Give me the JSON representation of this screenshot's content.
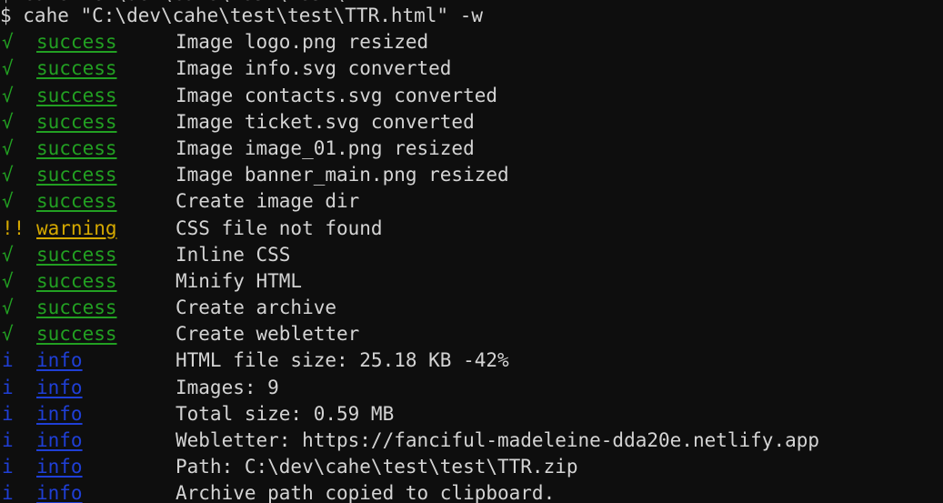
{
  "terminal": {
    "background_color": "#0e0e0e",
    "foreground_color": "#d4d4d4",
    "scrollback_partial_line": "$ cahe \"C:\\dev\\cahe\\test\\test\\TTR.html\" -w",
    "prompt_symbol": "$",
    "command_line": "$ cahe \"C:\\dev\\cahe\\test\\test\\TTR.html\" -w"
  },
  "colors": {
    "success": "#22a022",
    "warning": "#d4a800",
    "info": "#1f3fd6",
    "text": "#d4d4d4",
    "background": "#0e0e0e"
  },
  "markers": {
    "success": "√",
    "warning": "!!",
    "info": "i"
  },
  "log": {
    "rows": [
      {
        "marker": "√",
        "level": "success",
        "label": "success",
        "message": "Image logo.png resized"
      },
      {
        "marker": "√",
        "level": "success",
        "label": "success",
        "message": "Image info.svg converted"
      },
      {
        "marker": "√",
        "level": "success",
        "label": "success",
        "message": "Image contacts.svg converted"
      },
      {
        "marker": "√",
        "level": "success",
        "label": "success",
        "message": "Image ticket.svg converted"
      },
      {
        "marker": "√",
        "level": "success",
        "label": "success",
        "message": "Image image_01.png resized"
      },
      {
        "marker": "√",
        "level": "success",
        "label": "success",
        "message": "Image banner_main.png resized"
      },
      {
        "marker": "√",
        "level": "success",
        "label": "success",
        "message": "Create image dir"
      },
      {
        "marker": "!!",
        "level": "warning",
        "label": "warning",
        "message": "CSS file not found"
      },
      {
        "marker": "√",
        "level": "success",
        "label": "success",
        "message": "Inline CSS"
      },
      {
        "marker": "√",
        "level": "success",
        "label": "success",
        "message": "Minify HTML"
      },
      {
        "marker": "√",
        "level": "success",
        "label": "success",
        "message": "Create archive"
      },
      {
        "marker": "√",
        "level": "success",
        "label": "success",
        "message": "Create webletter"
      },
      {
        "marker": "i",
        "level": "info",
        "label": "info",
        "message": "HTML file size: 25.18 KB -42%"
      },
      {
        "marker": "i",
        "level": "info",
        "label": "info",
        "message": "Images: 9"
      },
      {
        "marker": "i",
        "level": "info",
        "label": "info",
        "message": "Total size: 0.59 MB"
      },
      {
        "marker": "i",
        "level": "info",
        "label": "info",
        "message": "Webletter: https://fanciful-madeleine-dda20e.netlify.app"
      },
      {
        "marker": "i",
        "level": "info",
        "label": "info",
        "message": "Path: C:\\dev\\cahe\\test\\test\\TTR.zip"
      },
      {
        "marker": "i",
        "level": "info",
        "label": "info",
        "message": "Archive path copied to clipboard."
      }
    ]
  }
}
